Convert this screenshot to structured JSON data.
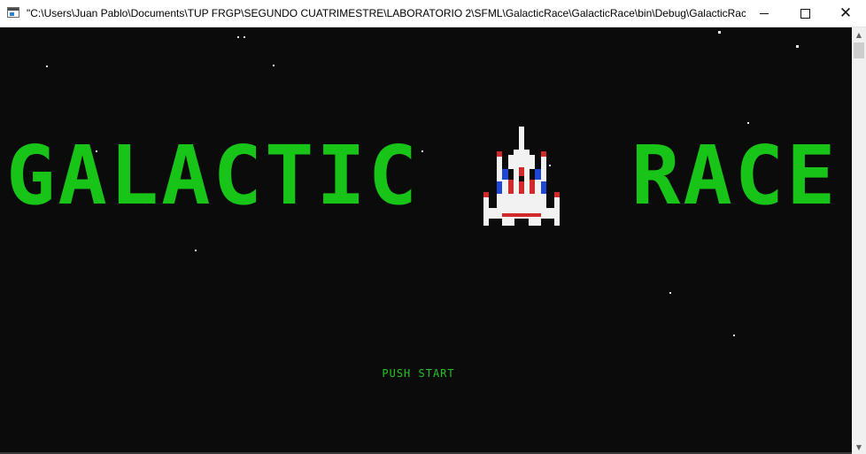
{
  "window": {
    "title": "\"C:\\Users\\Juan Pablo\\Documents\\TUP FRGP\\SEGUNDO CUATRIMESTRE\\LABORATORIO 2\\SFML\\GalacticRace\\GalacticRace\\bin\\Debug\\GalacticRace.ex...",
    "minimize_icon": "minimize-icon",
    "maximize_icon": "maximize-icon",
    "close_icon": "close-icon",
    "close_glyph": "✕"
  },
  "game": {
    "logo_left": "GALACTIC",
    "logo_right": "RACE",
    "push_start": "PUSH START",
    "logo_color": "#19c419",
    "background_color": "#0b0b0b"
  },
  "scrollbar": {
    "up_glyph": "▲",
    "down_glyph": "▼"
  }
}
